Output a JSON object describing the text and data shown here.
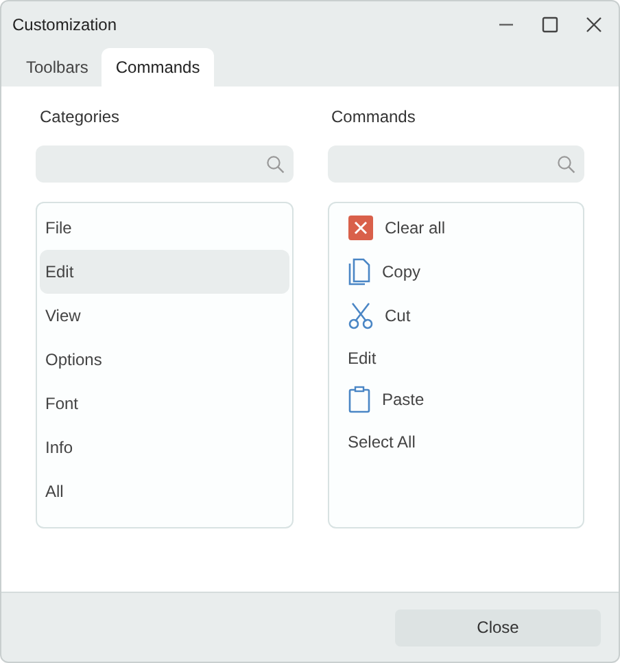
{
  "window": {
    "title": "Customization"
  },
  "tabs": [
    {
      "label": "Toolbars",
      "selected": false
    },
    {
      "label": "Commands",
      "selected": true
    }
  ],
  "categories": {
    "title": "Categories",
    "items": [
      {
        "label": "File",
        "selected": false
      },
      {
        "label": "Edit",
        "selected": true
      },
      {
        "label": "View",
        "selected": false
      },
      {
        "label": "Options",
        "selected": false
      },
      {
        "label": "Font",
        "selected": false
      },
      {
        "label": "Info",
        "selected": false
      },
      {
        "label": "All",
        "selected": false
      }
    ]
  },
  "commands": {
    "title": "Commands",
    "items": [
      {
        "label": "Clear all",
        "kind": "clear"
      },
      {
        "label": "Copy",
        "kind": "copy"
      },
      {
        "label": "Cut",
        "kind": "cut"
      },
      {
        "label": "Edit",
        "kind": "plain"
      },
      {
        "label": "Paste",
        "kind": "paste"
      },
      {
        "label": "Select All",
        "kind": "plain"
      }
    ]
  },
  "buttons": [
    "Close"
  ]
}
